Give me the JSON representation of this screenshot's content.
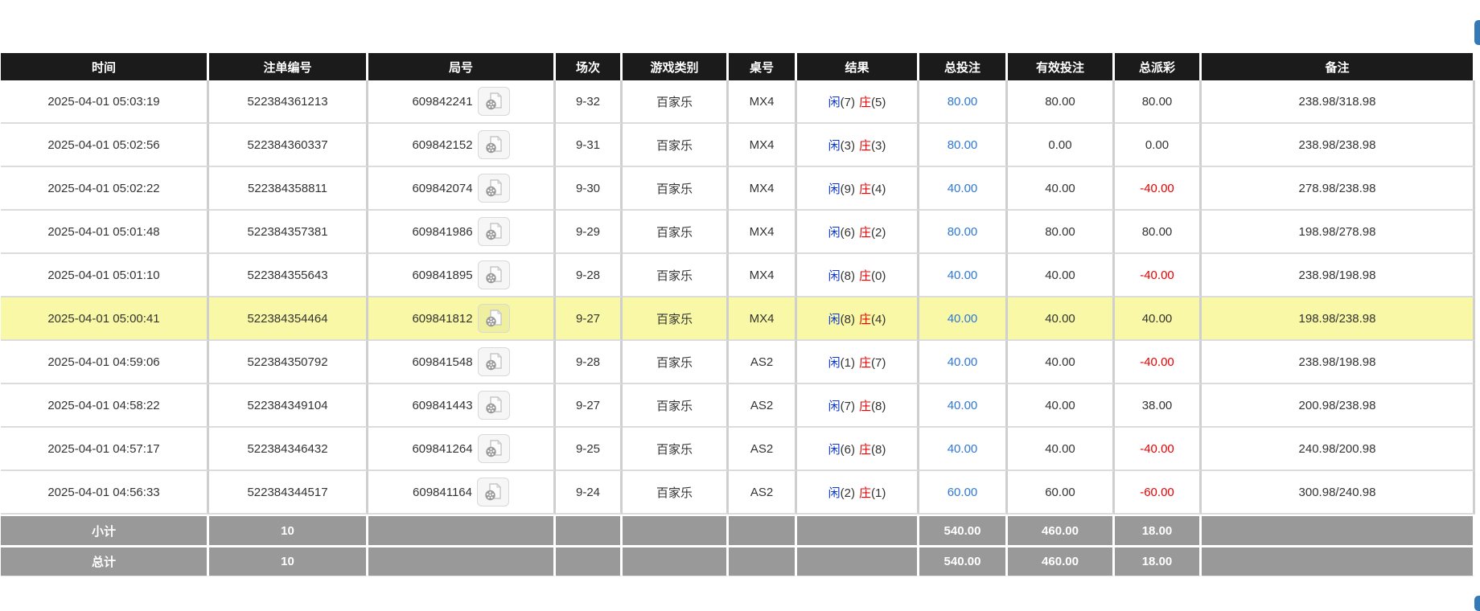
{
  "colors": {
    "header-bg": "#1b1b1b",
    "footer-bg": "#999999",
    "highlight-yellow": "#f8f8a6",
    "link-blue": "#2e77d9",
    "player-blue": "#0a35cf",
    "banker-red": "#ee0000",
    "negative-red": "#e60000",
    "edge-button-blue": "#3579b6",
    "row-border": "#dcdcdc",
    "col-border": "#cfcfcf"
  },
  "table": {
    "columns": [
      {
        "key": "time",
        "label": "时间"
      },
      {
        "key": "bet_id",
        "label": "注单编号"
      },
      {
        "key": "round_id",
        "label": "局号"
      },
      {
        "key": "session",
        "label": "场次"
      },
      {
        "key": "game_type",
        "label": "游戏类别"
      },
      {
        "key": "table_id",
        "label": "桌号"
      },
      {
        "key": "result",
        "label": "结果"
      },
      {
        "key": "total_bet",
        "label": "总投注"
      },
      {
        "key": "valid_bet",
        "label": "有效投注"
      },
      {
        "key": "total_payout",
        "label": "总派彩"
      },
      {
        "key": "remark",
        "label": "备注"
      }
    ],
    "rows": [
      {
        "time": "2025-04-01 05:03:19",
        "bet_id": "522384361213",
        "round_id": "609842241",
        "session": "9-32",
        "game_type": "百家乐",
        "table_id": "MX4",
        "result": {
          "player_label": "闲",
          "player_score": "(7)",
          "banker_label": "庄",
          "banker_score": "(5)"
        },
        "total_bet": "80.00",
        "valid_bet": "80.00",
        "total_payout": "80.00",
        "remark": "238.98/318.98",
        "highlighted": false
      },
      {
        "time": "2025-04-01 05:02:56",
        "bet_id": "522384360337",
        "round_id": "609842152",
        "session": "9-31",
        "game_type": "百家乐",
        "table_id": "MX4",
        "result": {
          "player_label": "闲",
          "player_score": "(3)",
          "banker_label": "庄",
          "banker_score": "(3)"
        },
        "total_bet": "80.00",
        "valid_bet": "0.00",
        "total_payout": "0.00",
        "remark": "238.98/238.98",
        "highlighted": false
      },
      {
        "time": "2025-04-01 05:02:22",
        "bet_id": "522384358811",
        "round_id": "609842074",
        "session": "9-30",
        "game_type": "百家乐",
        "table_id": "MX4",
        "result": {
          "player_label": "闲",
          "player_score": "(9)",
          "banker_label": "庄",
          "banker_score": "(4)"
        },
        "total_bet": "40.00",
        "valid_bet": "40.00",
        "total_payout": "-40.00",
        "remark": "278.98/238.98",
        "highlighted": false
      },
      {
        "time": "2025-04-01 05:01:48",
        "bet_id": "522384357381",
        "round_id": "609841986",
        "session": "9-29",
        "game_type": "百家乐",
        "table_id": "MX4",
        "result": {
          "player_label": "闲",
          "player_score": "(6)",
          "banker_label": "庄",
          "banker_score": "(2)"
        },
        "total_bet": "80.00",
        "valid_bet": "80.00",
        "total_payout": "80.00",
        "remark": "198.98/278.98",
        "highlighted": false
      },
      {
        "time": "2025-04-01 05:01:10",
        "bet_id": "522384355643",
        "round_id": "609841895",
        "session": "9-28",
        "game_type": "百家乐",
        "table_id": "MX4",
        "result": {
          "player_label": "闲",
          "player_score": "(8)",
          "banker_label": "庄",
          "banker_score": "(0)"
        },
        "total_bet": "40.00",
        "valid_bet": "40.00",
        "total_payout": "-40.00",
        "remark": "238.98/198.98",
        "highlighted": false
      },
      {
        "time": "2025-04-01 05:00:41",
        "bet_id": "522384354464",
        "round_id": "609841812",
        "session": "9-27",
        "game_type": "百家乐",
        "table_id": "MX4",
        "result": {
          "player_label": "闲",
          "player_score": "(8)",
          "banker_label": "庄",
          "banker_score": "(4)"
        },
        "total_bet": "40.00",
        "valid_bet": "40.00",
        "total_payout": "40.00",
        "remark": "198.98/238.98",
        "highlighted": true
      },
      {
        "time": "2025-04-01 04:59:06",
        "bet_id": "522384350792",
        "round_id": "609841548",
        "session": "9-28",
        "game_type": "百家乐",
        "table_id": "AS2",
        "result": {
          "player_label": "闲",
          "player_score": "(1)",
          "banker_label": "庄",
          "banker_score": "(7)"
        },
        "total_bet": "40.00",
        "valid_bet": "40.00",
        "total_payout": "-40.00",
        "remark": "238.98/198.98",
        "highlighted": false
      },
      {
        "time": "2025-04-01 04:58:22",
        "bet_id": "522384349104",
        "round_id": "609841443",
        "session": "9-27",
        "game_type": "百家乐",
        "table_id": "AS2",
        "result": {
          "player_label": "闲",
          "player_score": "(7)",
          "banker_label": "庄",
          "banker_score": "(8)"
        },
        "total_bet": "40.00",
        "valid_bet": "40.00",
        "total_payout": "38.00",
        "remark": "200.98/238.98",
        "highlighted": false
      },
      {
        "time": "2025-04-01 04:57:17",
        "bet_id": "522384346432",
        "round_id": "609841264",
        "session": "9-25",
        "game_type": "百家乐",
        "table_id": "AS2",
        "result": {
          "player_label": "闲",
          "player_score": "(6)",
          "banker_label": "庄",
          "banker_score": "(8)"
        },
        "total_bet": "40.00",
        "valid_bet": "40.00",
        "total_payout": "-40.00",
        "remark": "240.98/200.98",
        "highlighted": false
      },
      {
        "time": "2025-04-01 04:56:33",
        "bet_id": "522384344517",
        "round_id": "609841164",
        "session": "9-24",
        "game_type": "百家乐",
        "table_id": "AS2",
        "result": {
          "player_label": "闲",
          "player_score": "(2)",
          "banker_label": "庄",
          "banker_score": "(1)"
        },
        "total_bet": "60.00",
        "valid_bet": "60.00",
        "total_payout": "-60.00",
        "remark": "300.98/240.98",
        "highlighted": false
      }
    ],
    "subtotal": {
      "label": "小计",
      "count": "10",
      "total_bet": "540.00",
      "valid_bet": "460.00",
      "total_payout": "18.00"
    },
    "total": {
      "label": "总计",
      "count": "10",
      "total_bet": "540.00",
      "valid_bet": "460.00",
      "total_payout": "18.00"
    }
  }
}
